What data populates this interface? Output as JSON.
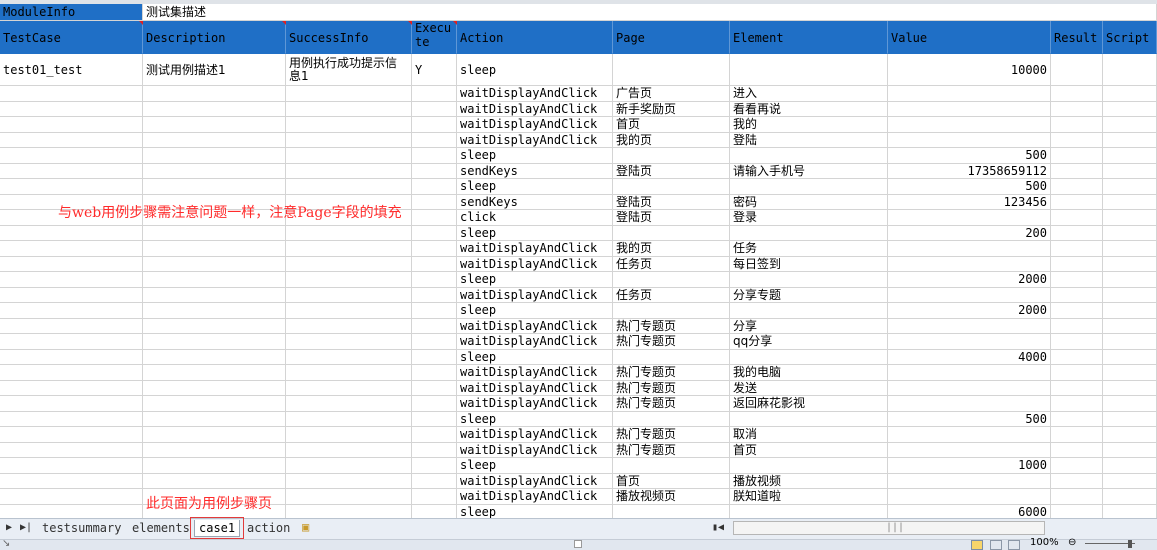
{
  "module": {
    "label": "ModuleInfo",
    "value": "测试集描述"
  },
  "headers": [
    "TestCase",
    "Description",
    "SuccessInfo",
    "Execute",
    "Action",
    "Page",
    "Element",
    "Value",
    "Result",
    "Script"
  ],
  "case": {
    "testcase": "test01_test",
    "description": "测试用例描述1",
    "success_info": "用例执行成功提示信息1",
    "execute": "Y"
  },
  "steps": [
    {
      "action": "sleep",
      "page": "",
      "element": "",
      "value": "10000"
    },
    {
      "action": "waitDisplayAndClick",
      "page": "广告页",
      "element": "进入",
      "value": ""
    },
    {
      "action": "waitDisplayAndClick",
      "page": "新手奖励页",
      "element": "看看再说",
      "value": ""
    },
    {
      "action": "waitDisplayAndClick",
      "page": "首页",
      "element": "我的",
      "value": ""
    },
    {
      "action": "waitDisplayAndClick",
      "page": "我的页",
      "element": "登陆",
      "value": ""
    },
    {
      "action": "sleep",
      "page": "",
      "element": "",
      "value": "500"
    },
    {
      "action": "sendKeys",
      "page": "登陆页",
      "element": "请输入手机号",
      "value": "17358659112"
    },
    {
      "action": "sleep",
      "page": "",
      "element": "",
      "value": "500"
    },
    {
      "action": "sendKeys",
      "page": "登陆页",
      "element": "密码",
      "value": "123456"
    },
    {
      "action": "click",
      "page": "登陆页",
      "element": "登录",
      "value": ""
    },
    {
      "action": "sleep",
      "page": "",
      "element": "",
      "value": "200"
    },
    {
      "action": "waitDisplayAndClick",
      "page": "我的页",
      "element": "任务",
      "value": ""
    },
    {
      "action": "waitDisplayAndClick",
      "page": "任务页",
      "element": "每日签到",
      "value": ""
    },
    {
      "action": "sleep",
      "page": "",
      "element": "",
      "value": "2000"
    },
    {
      "action": "waitDisplayAndClick",
      "page": "任务页",
      "element": "分享专题",
      "value": ""
    },
    {
      "action": "sleep",
      "page": "",
      "element": "",
      "value": "2000"
    },
    {
      "action": "waitDisplayAndClick",
      "page": "热门专题页",
      "element": "分享",
      "value": ""
    },
    {
      "action": "waitDisplayAndClick",
      "page": "热门专题页",
      "element": "qq分享",
      "value": ""
    },
    {
      "action": "sleep",
      "page": "",
      "element": "",
      "value": "4000"
    },
    {
      "action": "waitDisplayAndClick",
      "page": "热门专题页",
      "element": "我的电脑",
      "value": ""
    },
    {
      "action": "waitDisplayAndClick",
      "page": "热门专题页",
      "element": "发送",
      "value": ""
    },
    {
      "action": "waitDisplayAndClick",
      "page": "热门专题页",
      "element": "返回麻花影视",
      "value": ""
    },
    {
      "action": "sleep",
      "page": "",
      "element": "",
      "value": "500"
    },
    {
      "action": "waitDisplayAndClick",
      "page": "热门专题页",
      "element": "取消",
      "value": ""
    },
    {
      "action": "waitDisplayAndClick",
      "page": "热门专题页",
      "element": "首页",
      "value": ""
    },
    {
      "action": "sleep",
      "page": "",
      "element": "",
      "value": "1000"
    },
    {
      "action": "waitDisplayAndClick",
      "page": "首页",
      "element": "播放视频",
      "value": ""
    },
    {
      "action": "waitDisplayAndClick",
      "page": "播放视频页",
      "element": "朕知道啦",
      "value": ""
    },
    {
      "action": "sleep",
      "page": "",
      "element": "",
      "value": "6000"
    }
  ],
  "annotations": {
    "steps_note": "与web用例步骤需注意问题一样，注意Page字段的填充",
    "page_note": "此页面为用例步骤页"
  },
  "sheet_tabs": [
    "testsummary",
    "elements",
    "case1",
    "action"
  ],
  "active_tab": "case1",
  "status": {
    "zoom": "100%"
  },
  "colors": {
    "header_bg": "#1f6fc6",
    "annotation": "#ff2b2b"
  }
}
